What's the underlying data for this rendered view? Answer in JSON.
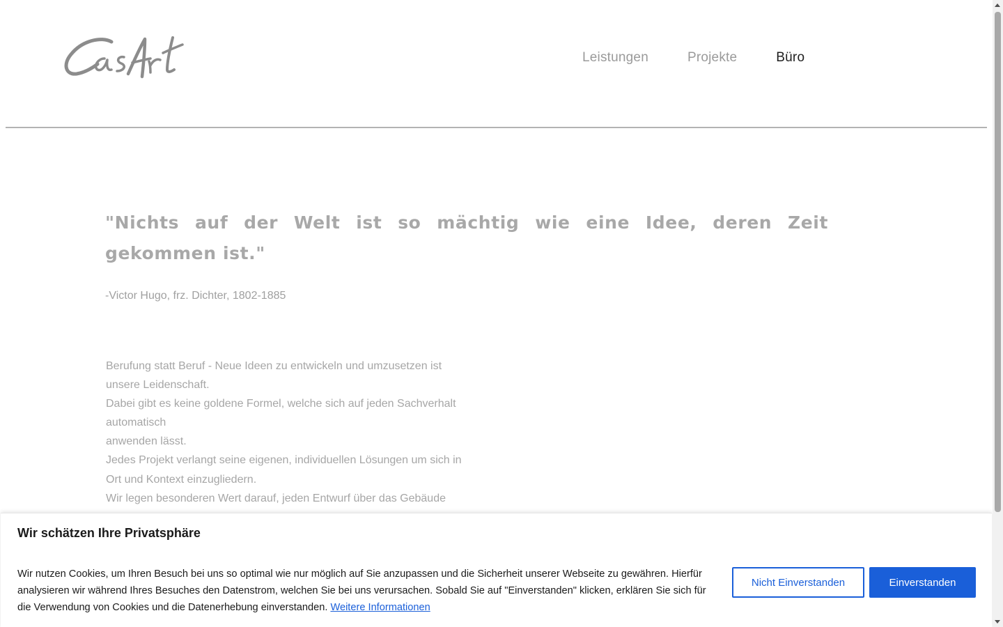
{
  "header": {
    "logo_text": "CasArt",
    "nav": [
      {
        "label": "Leistungen",
        "active": false
      },
      {
        "label": "Projekte",
        "active": false
      },
      {
        "label": "Büro",
        "active": true
      }
    ]
  },
  "main": {
    "quote": "\"Nichts auf der Welt ist so mächtig wie eine Idee, deren Zeit gekommen ist.\"",
    "author": "-Victor Hugo, frz. Dichter, 1802-1885",
    "paragraph_lines": [
      "Berufung statt Beruf - Neue Ideen zu entwickeln und umzusetzen ist",
      "unsere Leidenschaft.",
      "Dabei gibt es keine goldene Formel, welche sich auf jeden Sachverhalt",
      "automatisch",
      "anwenden lässt.",
      "Jedes Projekt verlangt seine eigenen, individuellen Lösungen um sich in",
      "Ort und Kontext einzugliedern.",
      "Wir legen besonderen Wert darauf, jeden Entwurf über das Gebäude"
    ]
  },
  "cookie_banner": {
    "title": "Wir schätzen Ihre Privatsphäre",
    "text": "Wir nutzen Cookies, um Ihren Besuch bei uns so optimal wie nur möglich auf Sie anzupassen und die Sicherheit unserer Webseite zu gewähren. Hierfür analysieren wir während Ihres Besuches den Datenstrom, welchen Sie bei uns verursachen. Sobald Sie auf \"Einverstanden\" klicken, erklären Sie sich für die Verwendung von Cookies und die Datenerhebung einverstanden.",
    "more_info_link": "Weitere Informationen",
    "decline_label": "Nicht Einverstanden",
    "accept_label": "Einverstanden"
  },
  "colors": {
    "accent": "#1a5fd9",
    "nav_inactive": "#9a9a9a",
    "nav_active": "#1e1e1e",
    "text_muted": "#a6a6a6"
  }
}
